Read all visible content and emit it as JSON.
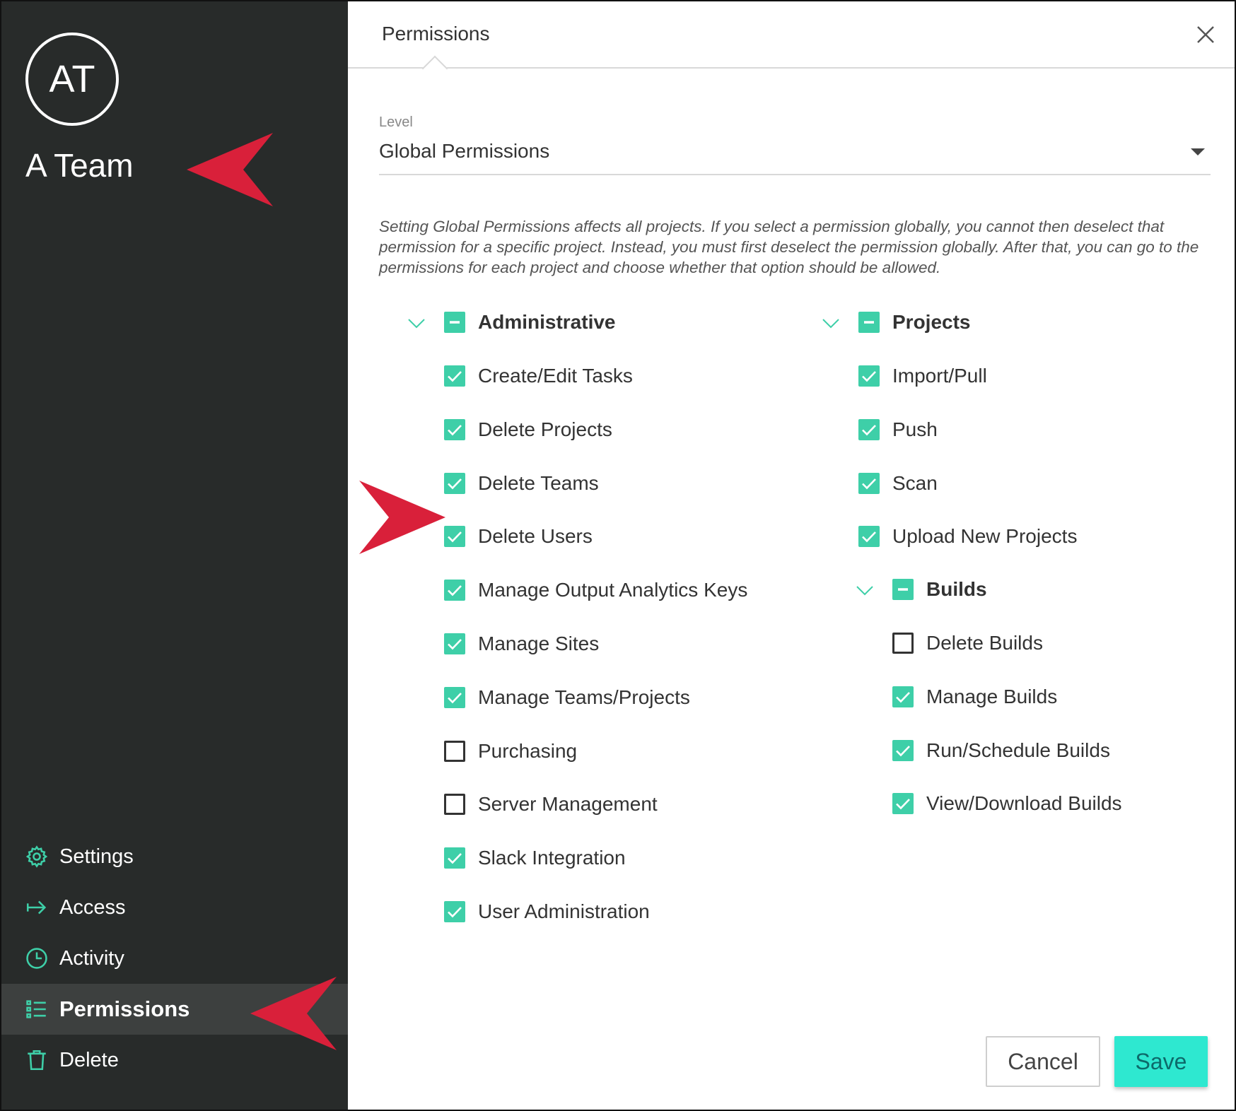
{
  "sidebar": {
    "avatar_initials": "AT",
    "team_name": "A Team",
    "nav": [
      {
        "label": "Settings",
        "icon": "gear-icon"
      },
      {
        "label": "Access",
        "icon": "arrow-right-icon"
      },
      {
        "label": "Activity",
        "icon": "clock-icon"
      },
      {
        "label": "Permissions",
        "icon": "list-icon",
        "active": true
      },
      {
        "label": "Delete",
        "icon": "trash-icon"
      }
    ]
  },
  "panel": {
    "tab_title": "Permissions",
    "level_label": "Level",
    "level_value": "Global Permissions",
    "info_text": "Setting Global Permissions affects all projects. If you select a permission globally, you cannot then deselect that permission for a specific project. Instead, you must first deselect the permission globally. After that, you can go to the permissions for each project and choose whether that option should be allowed."
  },
  "groups": {
    "administrative": {
      "label": "Administrative",
      "state": "indeterminate",
      "items": [
        {
          "label": "Create/Edit Tasks",
          "checked": true
        },
        {
          "label": "Delete Projects",
          "checked": true
        },
        {
          "label": "Delete Teams",
          "checked": true
        },
        {
          "label": "Delete Users",
          "checked": true
        },
        {
          "label": "Manage Output Analytics Keys",
          "checked": true
        },
        {
          "label": "Manage Sites",
          "checked": true
        },
        {
          "label": "Manage Teams/Projects",
          "checked": true
        },
        {
          "label": "Purchasing",
          "checked": false
        },
        {
          "label": "Server Management",
          "checked": false
        },
        {
          "label": "Slack Integration",
          "checked": true
        },
        {
          "label": "User Administration",
          "checked": true
        }
      ]
    },
    "projects": {
      "label": "Projects",
      "state": "indeterminate",
      "items": [
        {
          "label": "Import/Pull",
          "checked": true
        },
        {
          "label": "Push",
          "checked": true
        },
        {
          "label": "Scan",
          "checked": true
        },
        {
          "label": "Upload New Projects",
          "checked": true
        }
      ]
    },
    "builds": {
      "label": "Builds",
      "state": "indeterminate",
      "items": [
        {
          "label": "Delete Builds",
          "checked": false
        },
        {
          "label": "Manage Builds",
          "checked": true
        },
        {
          "label": "Run/Schedule Builds",
          "checked": true
        },
        {
          "label": "View/Download Builds",
          "checked": true
        }
      ]
    }
  },
  "buttons": {
    "cancel": "Cancel",
    "save": "Save"
  },
  "colors": {
    "sidebar_bg": "#282b2a",
    "accent": "#3ecfa8",
    "save_bg": "#2ee8d0",
    "annotation_red": "#d9203a"
  }
}
